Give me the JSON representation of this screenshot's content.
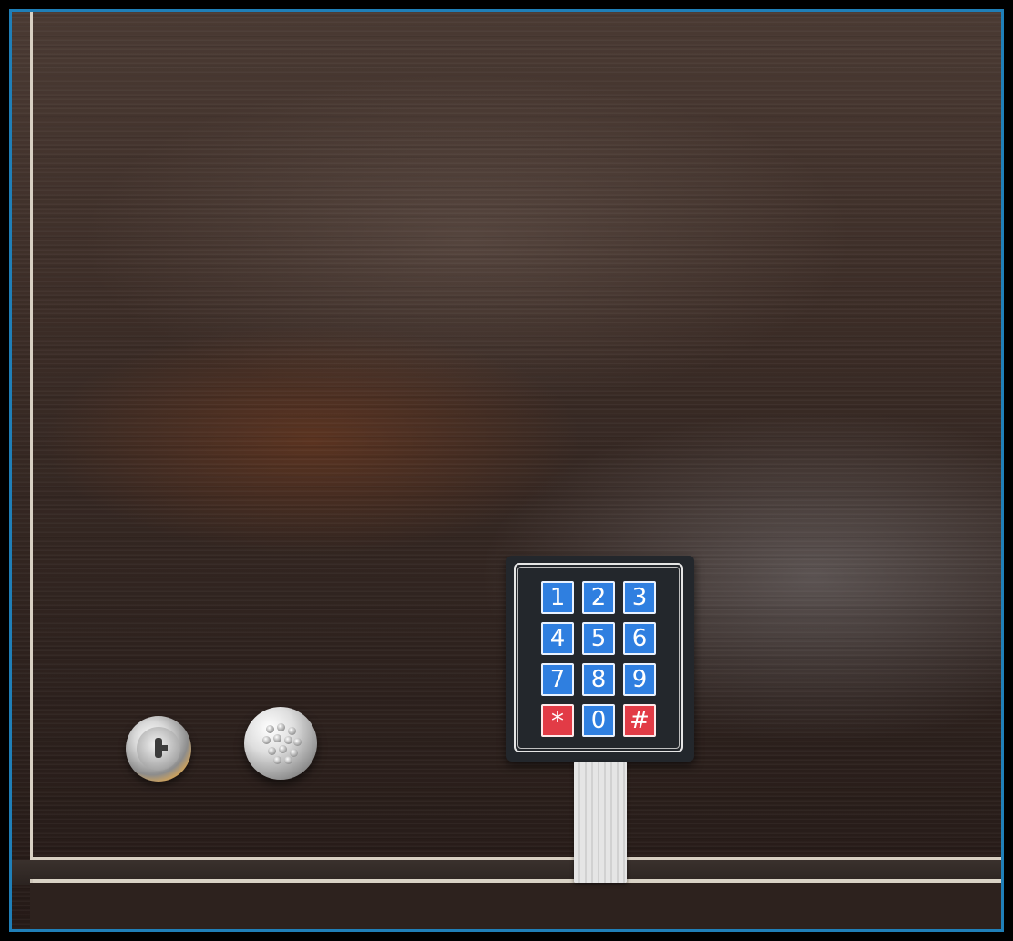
{
  "keypad": {
    "keys": [
      {
        "label": "1",
        "type": "digit",
        "color": "#2f7fe0"
      },
      {
        "label": "2",
        "type": "digit",
        "color": "#2f7fe0"
      },
      {
        "label": "3",
        "type": "digit",
        "color": "#2f7fe0"
      },
      {
        "label": "4",
        "type": "digit",
        "color": "#2f7fe0"
      },
      {
        "label": "5",
        "type": "digit",
        "color": "#2f7fe0"
      },
      {
        "label": "6",
        "type": "digit",
        "color": "#2f7fe0"
      },
      {
        "label": "7",
        "type": "digit",
        "color": "#2f7fe0"
      },
      {
        "label": "8",
        "type": "digit",
        "color": "#2f7fe0"
      },
      {
        "label": "9",
        "type": "digit",
        "color": "#2f7fe0"
      },
      {
        "label": "*",
        "type": "symbol",
        "color": "#e23b46"
      },
      {
        "label": "0",
        "type": "digit",
        "color": "#2f7fe0"
      },
      {
        "label": "#",
        "type": "symbol",
        "color": "#e23b46"
      }
    ]
  },
  "colors": {
    "frame_border": "#1f7fb8",
    "wood_dark": "#2e221e",
    "wood_mid": "#4a3a33",
    "trim": "#d8d0c3",
    "keypad_body": "#23272c"
  },
  "icons": {
    "lock": "key-lock-icon",
    "button": "push-button-icon",
    "ribbon": "ribbon-cable-icon"
  }
}
